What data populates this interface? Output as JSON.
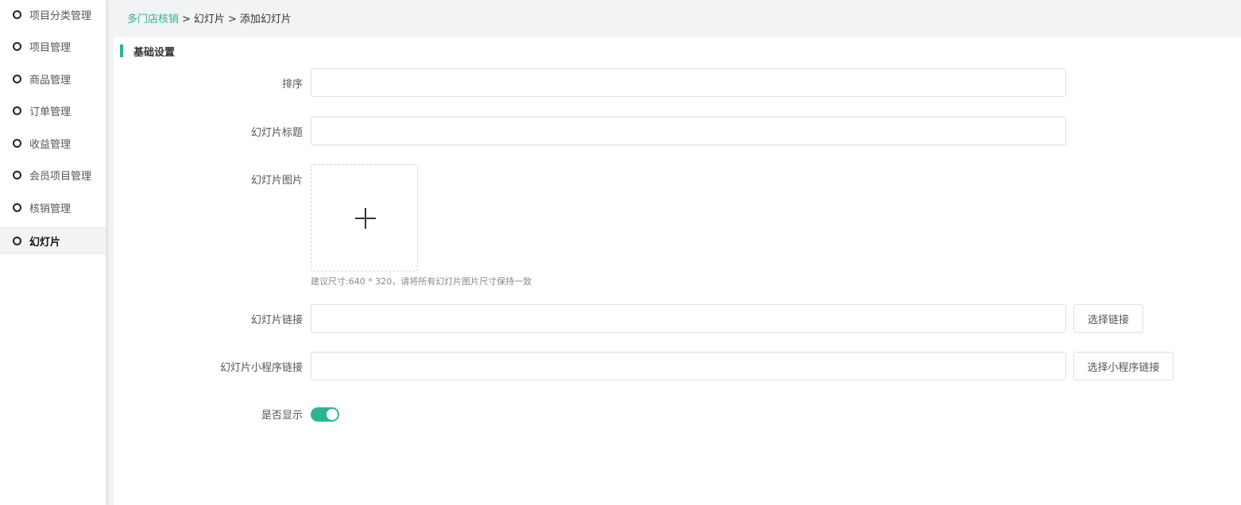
{
  "sidebar": {
    "items": [
      {
        "label": "项目分类管理",
        "active": false
      },
      {
        "label": "项目管理",
        "active": false
      },
      {
        "label": "商品管理",
        "active": false
      },
      {
        "label": "订单管理",
        "active": false
      },
      {
        "label": "收益管理",
        "active": false
      },
      {
        "label": "会员项目管理",
        "active": false
      },
      {
        "label": "核销管理",
        "active": false
      },
      {
        "label": "幻灯片",
        "active": true
      }
    ]
  },
  "breadcrumb": {
    "root": "多门店核销",
    "separator": ">",
    "level2": "幻灯片",
    "current": "添加幻灯片"
  },
  "section": {
    "title": "基础设置"
  },
  "form": {
    "sort": {
      "label": "排序",
      "value": ""
    },
    "slide_title": {
      "label": "幻灯片标题",
      "value": ""
    },
    "slide_image": {
      "label": "幻灯片图片",
      "hint": "建议尺寸:640 * 320，请将所有幻灯片图片尺寸保持一致"
    },
    "slide_link": {
      "label": "幻灯片链接",
      "value": "",
      "button": "选择链接"
    },
    "miniprogram_link": {
      "label": "幻灯片小程序链接",
      "value": "",
      "button": "选择小程序链接"
    },
    "show": {
      "label": "是否显示",
      "enabled": true
    }
  },
  "colors": {
    "accent": "#2bb592",
    "text": "#333333",
    "border": "#dcdfe6"
  }
}
